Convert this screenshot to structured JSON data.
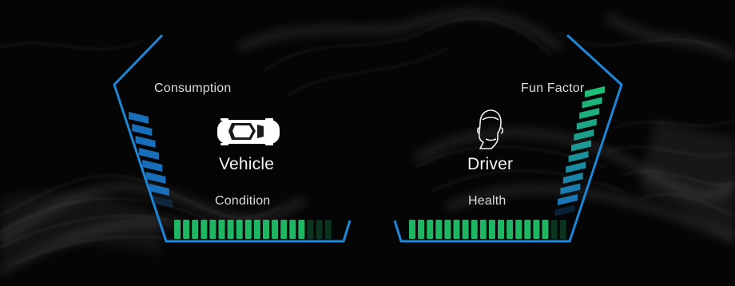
{
  "vehicle_panel": {
    "title": "Vehicle",
    "top_label": "Consumption",
    "bottom_label": "Condition",
    "consumption_level": 0.875,
    "condition_level": 0.833,
    "icon": "car-icon",
    "side_color": "#1a74c4",
    "bottom_color": "#21c56b"
  },
  "driver_panel": {
    "title": "Driver",
    "top_label": "Fun Factor",
    "bottom_label": "Health",
    "fun_factor_level": 0.9,
    "health_level": 0.889,
    "icon": "head-profile-icon",
    "side_color_top": "#1ec77a",
    "side_color_bottom": "#1a74c4",
    "bottom_color": "#21c56b"
  },
  "frame_color": "#1e86d6",
  "background_color": "#050505"
}
